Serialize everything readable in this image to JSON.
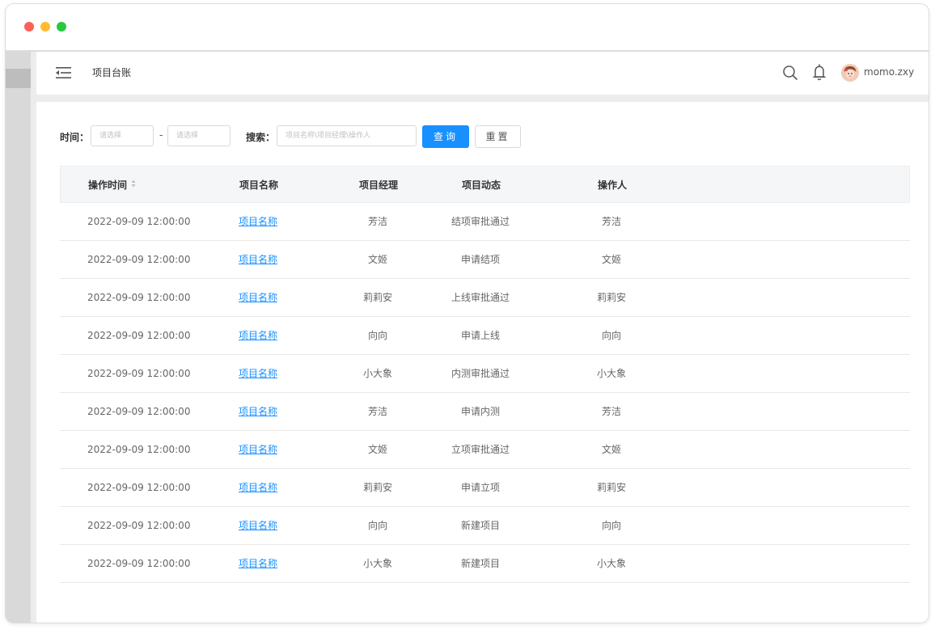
{
  "window": {
    "controls": [
      "close",
      "minimize",
      "maximize"
    ]
  },
  "header": {
    "menu_icon": "menu-fold-icon",
    "breadcrumb": "项目台账",
    "search_icon": "search-icon",
    "bell_icon": "bell-icon",
    "username": "momo.zxy"
  },
  "filters": {
    "time_label": "时间：",
    "start_placeholder": "请选择",
    "separator": "-",
    "end_placeholder": "请选择",
    "search_label": "搜索：",
    "search_placeholder": "项目名称\\项目经理\\操作人",
    "query_button": "查询",
    "reset_button": "重置"
  },
  "table": {
    "columns": [
      "操作时间",
      "项目名称",
      "项目经理",
      "项目动态",
      "操作人"
    ],
    "rows": [
      {
        "time": "2022-09-09 12:00:00",
        "name": "项目名称",
        "manager": "芳洁",
        "activity": "结项审批通过",
        "operator": "芳洁"
      },
      {
        "time": "2022-09-09 12:00:00",
        "name": "项目名称",
        "manager": "文姬",
        "activity": "申请结项",
        "operator": "文姬"
      },
      {
        "time": "2022-09-09 12:00:00",
        "name": "项目名称",
        "manager": "莉莉安",
        "activity": "上线审批通过",
        "operator": "莉莉安"
      },
      {
        "time": "2022-09-09 12:00:00",
        "name": "项目名称",
        "manager": "向向",
        "activity": "申请上线",
        "operator": "向向"
      },
      {
        "time": "2022-09-09 12:00:00",
        "name": "项目名称",
        "manager": "小大象",
        "activity": "内测审批通过",
        "operator": "小大象"
      },
      {
        "time": "2022-09-09 12:00:00",
        "name": "项目名称",
        "manager": "芳洁",
        "activity": "申请内测",
        "operator": "芳洁"
      },
      {
        "time": "2022-09-09 12:00:00",
        "name": "项目名称",
        "manager": "文姬",
        "activity": "立项审批通过",
        "operator": "文姬"
      },
      {
        "time": "2022-09-09 12:00:00",
        "name": "项目名称",
        "manager": "莉莉安",
        "activity": "申请立项",
        "operator": "莉莉安"
      },
      {
        "time": "2022-09-09 12:00:00",
        "name": "项目名称",
        "manager": "向向",
        "activity": "新建项目",
        "operator": "向向"
      },
      {
        "time": "2022-09-09 12:00:00",
        "name": "项目名称",
        "manager": "小大象",
        "activity": "新建项目",
        "operator": "小大象"
      }
    ]
  },
  "colors": {
    "primary": "#1890ff",
    "link": "#1890ff",
    "header_bg": "#f5f6f7"
  }
}
